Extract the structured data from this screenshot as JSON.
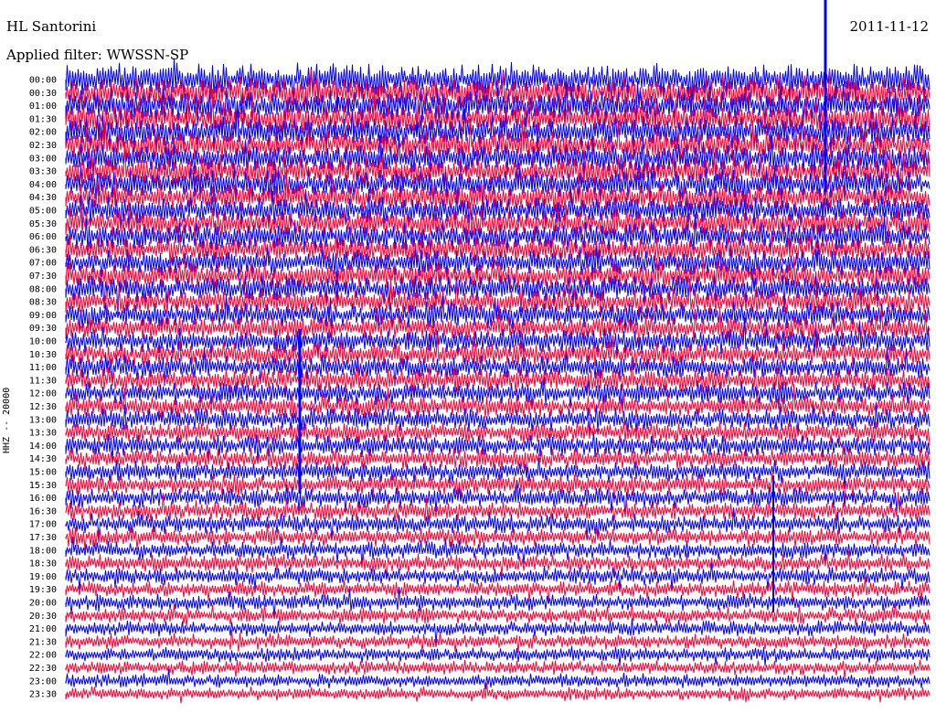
{
  "chart_data": {
    "type": "line",
    "title": "HL Santorini",
    "date": "2011-11-12",
    "filter_label": "Applied filter: WWSSN-SP",
    "ylabel": "HHZ -- 20000",
    "y_tick_labels": [
      "00:00",
      "00:30",
      "01:00",
      "01:30",
      "02:00",
      "02:30",
      "03:00",
      "03:30",
      "04:00",
      "04:30",
      "05:00",
      "05:30",
      "06:00",
      "06:30",
      "07:00",
      "07:30",
      "08:00",
      "08:30",
      "09:00",
      "09:30",
      "10:00",
      "10:30",
      "11:00",
      "11:30",
      "12:00",
      "12:30",
      "13:00",
      "13:30",
      "14:00",
      "14:30",
      "15:00",
      "15:30",
      "16:00",
      "16:30",
      "17:00",
      "17:30",
      "18:00",
      "18:30",
      "19:00",
      "19:30",
      "20:00",
      "20:30",
      "21:00",
      "21:30",
      "22:00",
      "22:30",
      "23:00",
      "23:30"
    ],
    "trace_colors": [
      "#0000ff",
      "#ff0033"
    ],
    "grid": false,
    "legend": "none"
  }
}
